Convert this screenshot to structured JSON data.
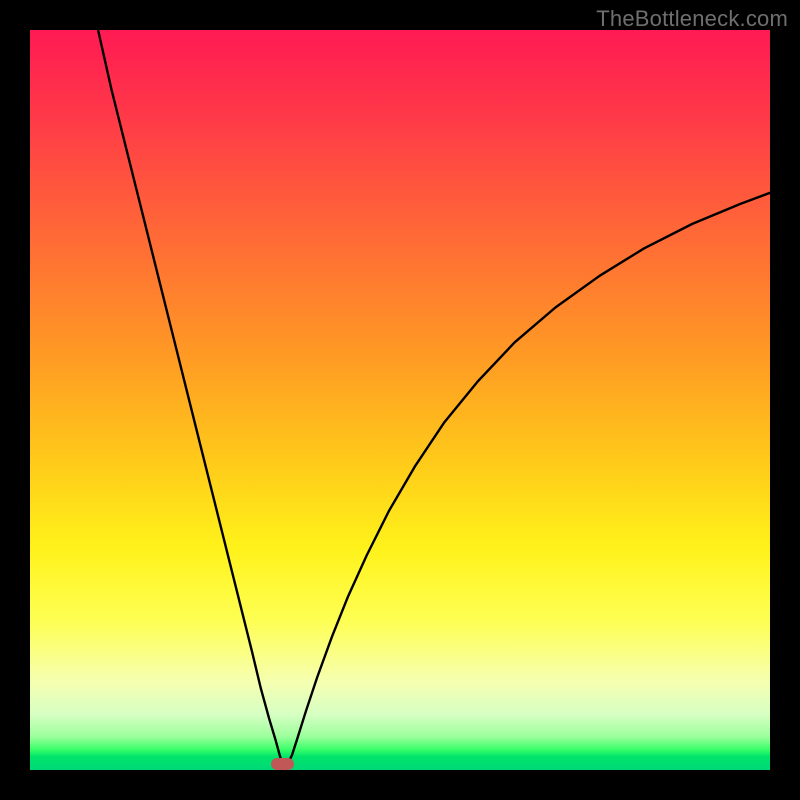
{
  "watermark": "TheBottleneck.com",
  "chart_data": {
    "type": "line",
    "title": "",
    "xlabel": "",
    "ylabel": "",
    "xlim": [
      0,
      100
    ],
    "ylim": [
      0,
      100
    ],
    "grid": false,
    "legend": false,
    "marker": {
      "x": 34.1,
      "y": 99.0,
      "w": 3.2,
      "h": 1.6,
      "color": "#c05858"
    },
    "gradient_stops": [
      {
        "pct": 0,
        "color": "#ff1a53"
      },
      {
        "pct": 12,
        "color": "#ff3a48"
      },
      {
        "pct": 28,
        "color": "#ff6a36"
      },
      {
        "pct": 44,
        "color": "#ff9a24"
      },
      {
        "pct": 58,
        "color": "#ffc91a"
      },
      {
        "pct": 70,
        "color": "#fff21a"
      },
      {
        "pct": 80,
        "color": "#feff55"
      },
      {
        "pct": 88,
        "color": "#f6ffb0"
      },
      {
        "pct": 92.5,
        "color": "#d6ffc3"
      },
      {
        "pct": 95.5,
        "color": "#9cff9c"
      },
      {
        "pct": 97.2,
        "color": "#3bff6a"
      },
      {
        "pct": 98.2,
        "color": "#00e46a"
      },
      {
        "pct": 100,
        "color": "#00d878"
      }
    ],
    "series": [
      {
        "name": "left-branch",
        "x": [
          9.2,
          11.0,
          13.0,
          15.0,
          17.0,
          19.0,
          21.0,
          23.0,
          25.0,
          27.0,
          28.5,
          30.0,
          31.2,
          32.3,
          33.2,
          33.8,
          34.1
        ],
        "y": [
          100.0,
          92.0,
          84.0,
          76.0,
          68.0,
          60.0,
          52.0,
          44.0,
          36.0,
          28.0,
          22.0,
          16.0,
          11.0,
          7.0,
          4.0,
          1.8,
          0.8
        ]
      },
      {
        "name": "right-branch",
        "x": [
          34.8,
          35.4,
          36.2,
          37.3,
          38.8,
          40.8,
          43.0,
          45.5,
          48.5,
          52.0,
          56.0,
          60.5,
          65.5,
          71.0,
          77.0,
          83.0,
          89.5,
          96.0,
          100.0
        ],
        "y": [
          0.8,
          2.0,
          4.5,
          8.0,
          12.5,
          18.0,
          23.5,
          29.0,
          35.0,
          41.0,
          47.0,
          52.5,
          57.8,
          62.5,
          66.8,
          70.5,
          73.8,
          76.5,
          78.0
        ]
      }
    ],
    "annotations": []
  }
}
